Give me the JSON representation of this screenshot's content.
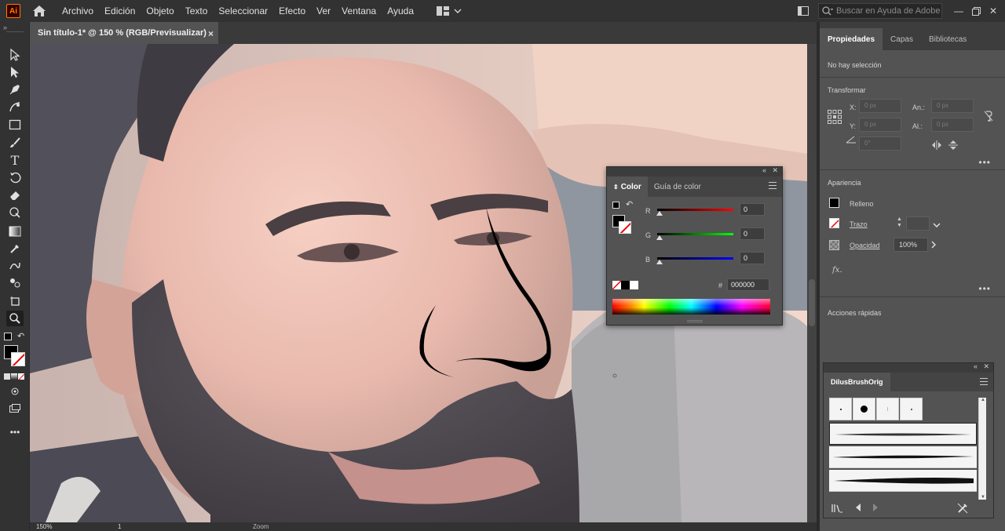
{
  "app": {
    "logo_text": "Ai"
  },
  "menu": [
    "Archivo",
    "Edición",
    "Objeto",
    "Texto",
    "Seleccionar",
    "Efecto",
    "Ver",
    "Ventana",
    "Ayuda"
  ],
  "search": {
    "placeholder": "Buscar en Ayuda de Adobe"
  },
  "document": {
    "tab_title": "Sin título-1* @ 150 % (RGB/Previsualizar)",
    "close_glyph": "×"
  },
  "status": {
    "zoom": "150%",
    "artboard": "1",
    "tool": "Zoom"
  },
  "properties": {
    "tabs": [
      "Propiedades",
      "Capas",
      "Bibliotecas"
    ],
    "no_selection": "No hay selección",
    "transform_title": "Transformar",
    "x_label": "X:",
    "y_label": "Y:",
    "w_label": "An.:",
    "h_label": "Al.:",
    "x_value": "0 px",
    "y_value": "0 px",
    "w_value": "0 px",
    "h_value": "0 px",
    "angle_value": "0°",
    "appearance_title": "Apariencia",
    "fill_label": "Relleno",
    "stroke_label": "Trazo",
    "opacity_label": "Opacidad",
    "opacity_value": "100%",
    "fx_label": "fx.",
    "quick_actions_title": "Acciones rápidas",
    "more": "•••"
  },
  "color_panel": {
    "tabs": [
      "Color",
      "Guía de color"
    ],
    "r_label": "R",
    "g_label": "G",
    "b_label": "B",
    "r_value": "0",
    "g_value": "0",
    "b_value": "0",
    "hex_label": "#",
    "hex_value": "000000"
  },
  "brush_panel": {
    "title": "DilusBrushOrig"
  }
}
